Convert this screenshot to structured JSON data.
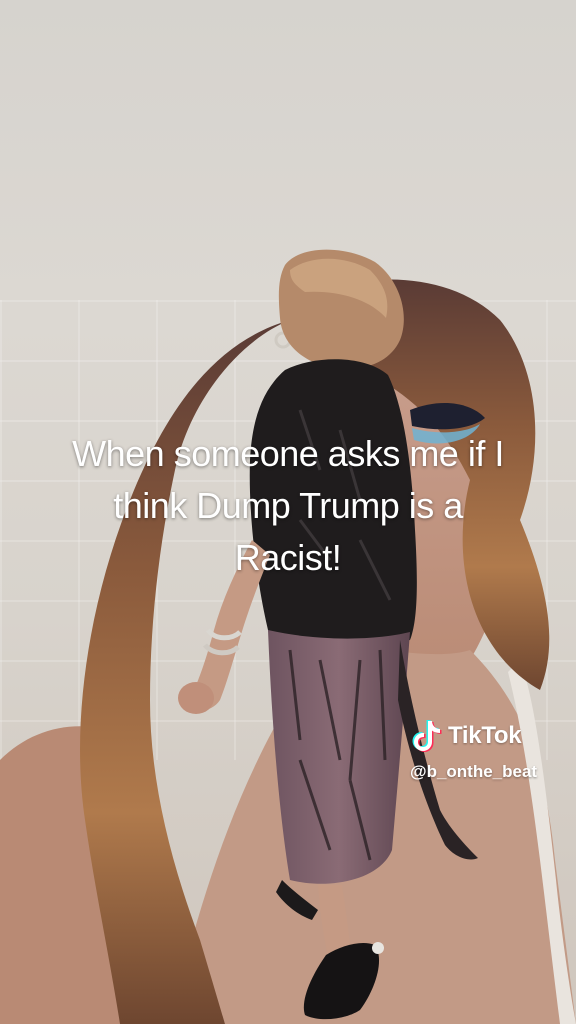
{
  "caption": {
    "line1": "When someone asks me if I",
    "line2": "think Dump Trump is a",
    "line3": "Racist!"
  },
  "watermark": {
    "brand": "TikTok",
    "handle": "@b_onthe_beat",
    "logo_icon": "tiktok-note-icon"
  },
  "colors": {
    "caption_text": "#ffffff",
    "tiktok_cyan": "#25f4ee",
    "tiktok_red": "#fe2c55"
  }
}
